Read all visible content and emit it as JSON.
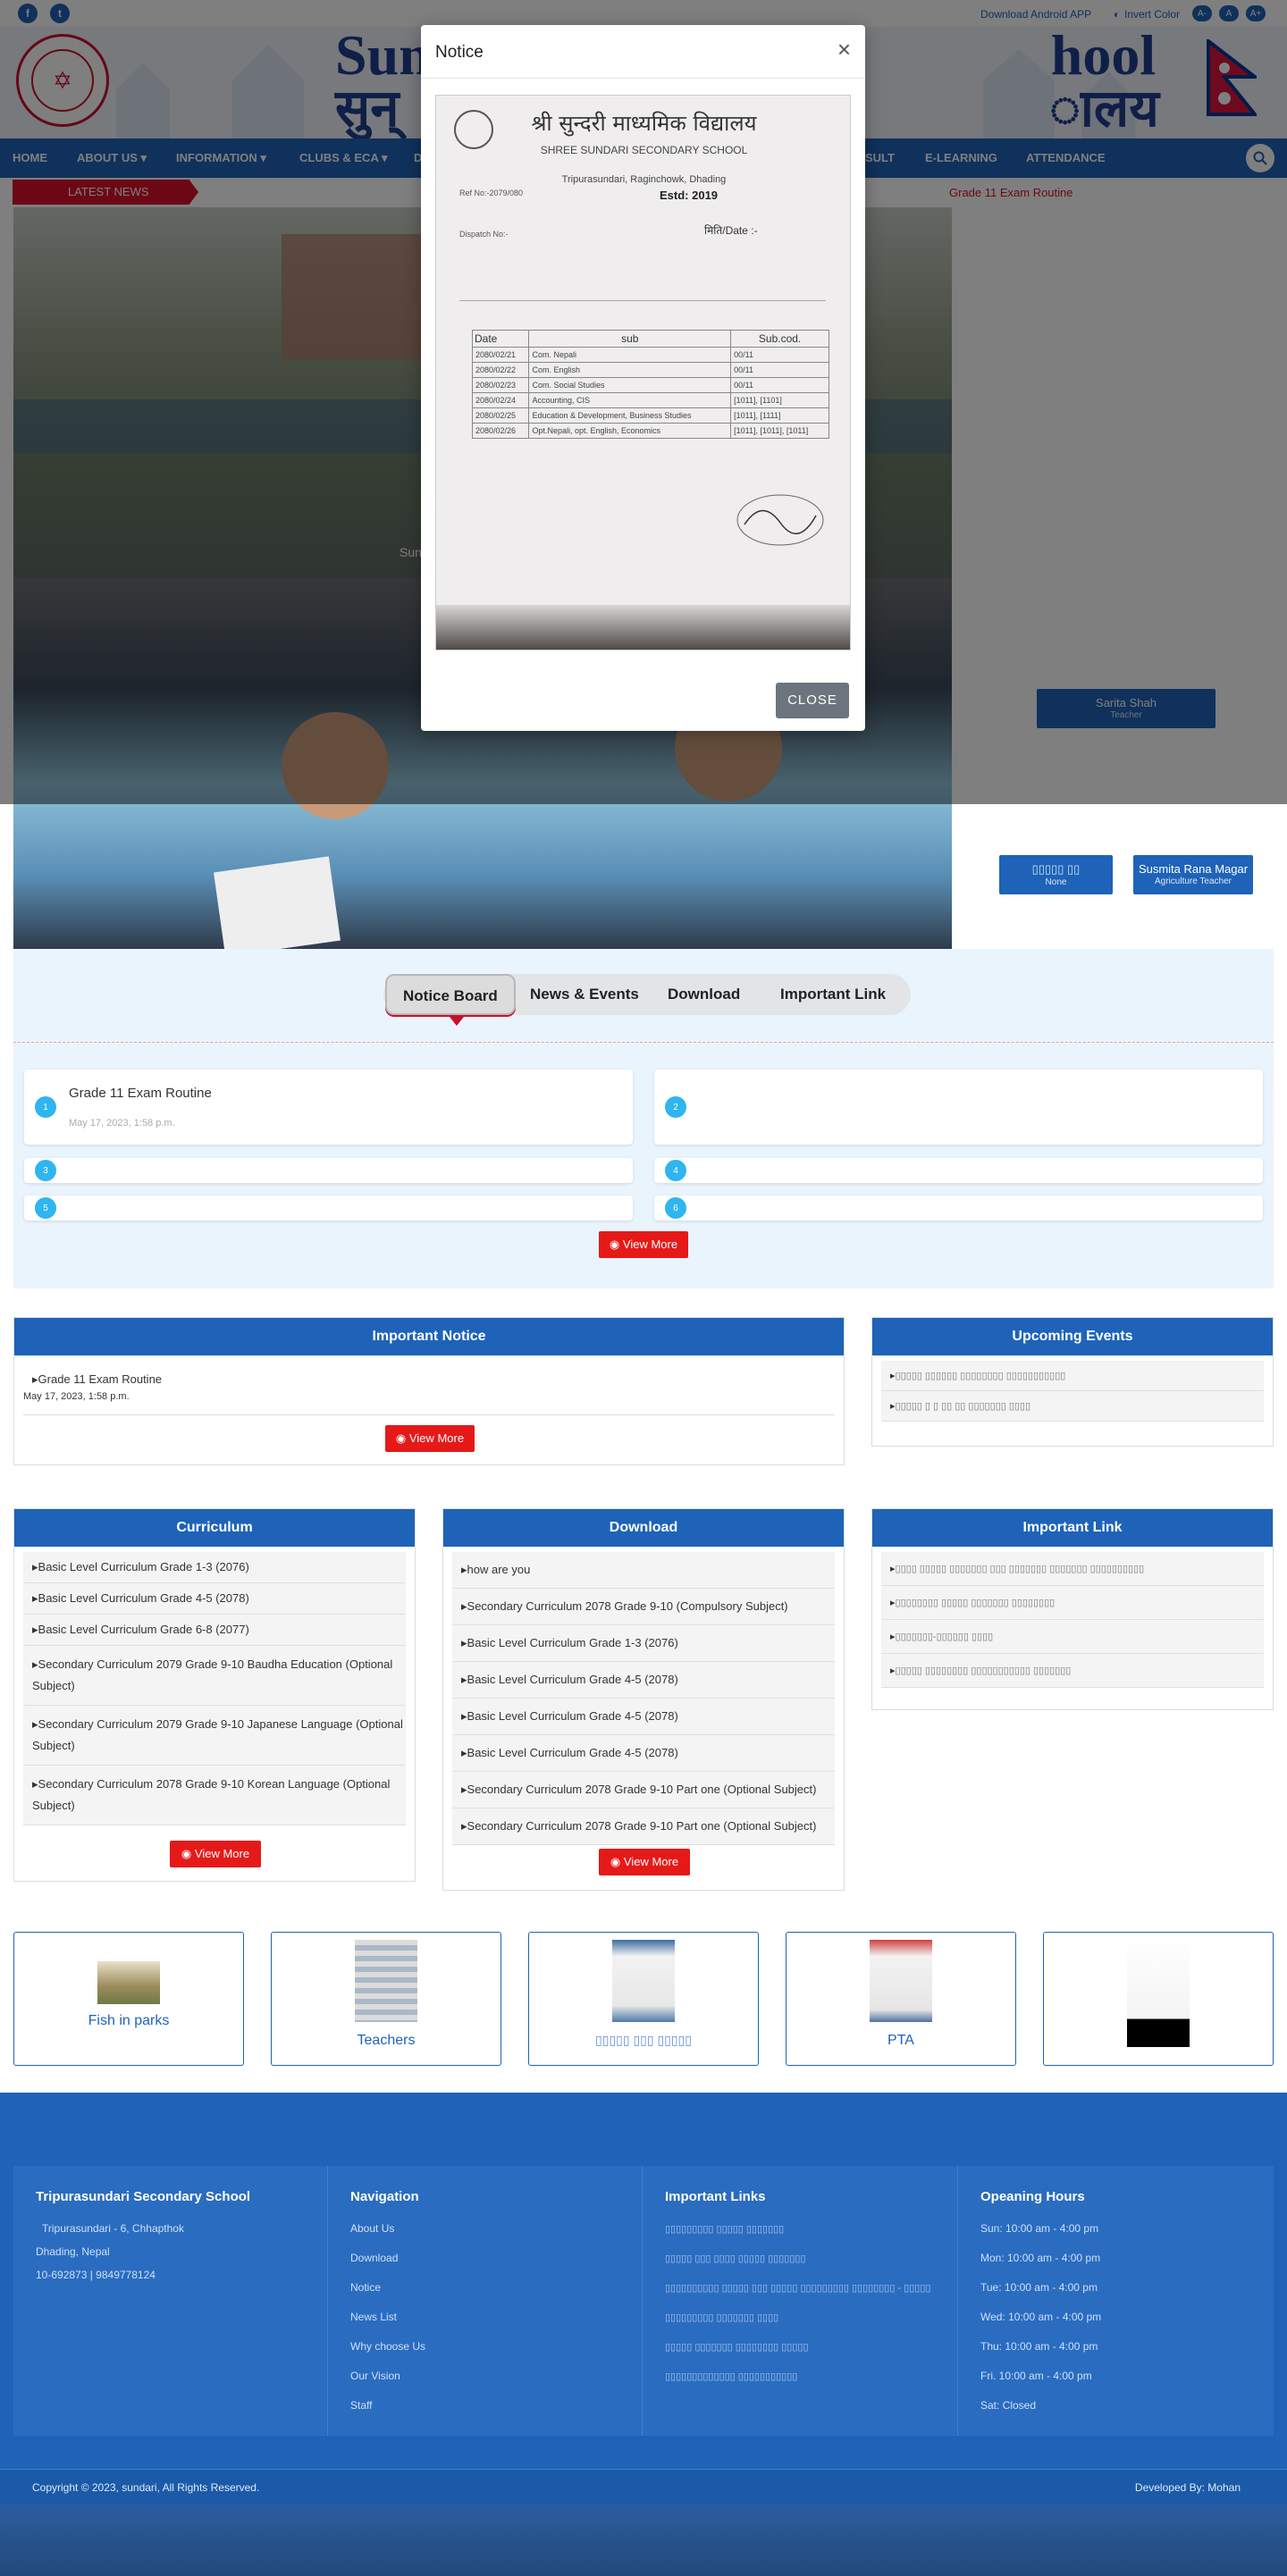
{
  "topbar": {
    "social": [
      "f",
      "t"
    ],
    "android_link": "Download Android APP",
    "invert_label": "Invert Color",
    "font_buttons": [
      "A-",
      "A",
      "A+"
    ]
  },
  "header": {
    "title_visible_left": "Sun",
    "title_visible_right": "hool",
    "subtitle_visible_left": "सुन्",
    "subtitle_visible_right": "ालय"
  },
  "nav": {
    "items": [
      "HOME",
      "ABOUT US",
      "INFORMATION",
      "CLUBS & ECA",
      "D",
      "SULT",
      "E-LEARNING",
      "ATTENDANCE"
    ]
  },
  "latest_news": {
    "label": "LATEST NEWS",
    "ticker": "Grade 11 Exam Routine"
  },
  "slider": {
    "caption": "Sun"
  },
  "staff": [
    {
      "name": "Sarita Shah",
      "role": "Teacher"
    },
    {
      "name": "▯▯▯▯▯ ▯▯",
      "role": "None"
    },
    {
      "name": "Susmita Rana Magar",
      "role": "Agriculture Teacher"
    }
  ],
  "tabs": [
    "Notice Board",
    "News & Events",
    "Download",
    "Important Link"
  ],
  "notice_board": {
    "items": [
      {
        "num": "1",
        "title": "Grade 11 Exam Routine",
        "date": "May 17, 2023, 1:58 p.m."
      },
      {
        "num": "2",
        "title": "",
        "date": ""
      },
      {
        "num": "3",
        "title": "",
        "date": ""
      },
      {
        "num": "4",
        "title": "",
        "date": ""
      },
      {
        "num": "5",
        "title": "",
        "date": ""
      },
      {
        "num": "6",
        "title": "",
        "date": ""
      }
    ],
    "view_more": "View More"
  },
  "important_notice": {
    "heading": "Important Notice",
    "item": "Grade 11 Exam Routine",
    "date": "May 17, 2023, 1:58 p.m.",
    "view_more": "View More"
  },
  "upcoming_events": {
    "heading": "Upcoming Events",
    "items": [
      "▯▯▯▯▯ ▯▯▯▯▯▯ ▯▯▯▯▯▯▯▯ ▯▯▯▯▯▯▯▯▯▯▯",
      "▯▯▯▯▯ ▯ ▯ ▯▯ ▯▯ ▯▯▯▯▯▯▯ ▯▯▯▯"
    ]
  },
  "curriculum": {
    "heading": "Curriculum",
    "items": [
      "Basic Level Curriculum Grade 1-3 (2076)",
      "Basic Level Curriculum Grade 4-5 (2078)",
      "Basic Level Curriculum Grade 6-8 (2077)",
      "Secondary Curriculum 2079 Grade 9-10 Baudha Education (Optional Subject)",
      "Secondary Curriculum 2079 Grade 9-10 Japanese Language (Optional Subject)",
      "Secondary Curriculum 2078 Grade 9-10 Korean Language (Optional Subject)"
    ],
    "view_more": "View More"
  },
  "download": {
    "heading": "Download",
    "items": [
      "how are you",
      "Secondary Curriculum 2078 Grade 9-10 (Compulsory Subject)",
      "Basic Level Curriculum Grade 1-3 (2076)",
      "Basic Level Curriculum Grade 4-5 (2078)",
      "Basic Level Curriculum Grade 4-5 (2078)",
      "Basic Level Curriculum Grade 4-5 (2078)",
      "Secondary Curriculum 2078 Grade 9-10 Part one (Optional Subject)",
      "Secondary Curriculum 2078 Grade 9-10 Part one (Optional Subject)"
    ],
    "view_more": "View More"
  },
  "important_link": {
    "heading": "Important Link",
    "items": [
      "▯▯▯▯ ▯▯▯▯▯ ▯▯▯▯▯▯▯ ▯▯▯ ▯▯▯▯▯▯▯ ▯▯▯▯▯▯▯ ▯▯▯▯▯▯▯▯▯▯",
      "▯▯▯▯▯▯▯▯ ▯▯▯▯▯ ▯▯▯▯▯▯▯ ▯▯▯▯▯▯▯▯",
      "▯▯▯▯▯▯▯-▯▯▯▯▯▯ ▯▯▯▯",
      "▯▯▯▯▯ ▯▯▯▯▯▯▯▯ ▯▯▯▯▯▯▯▯▯▯▯ ▯▯▯▯▯▯▯"
    ]
  },
  "gallery": [
    {
      "label": "Fish in parks"
    },
    {
      "label": "Teachers"
    },
    {
      "label": "▯▯▯▯▯ ▯▯▯ ▯▯▯▯▯"
    },
    {
      "label": "PTA"
    },
    {
      "label": ""
    }
  ],
  "footer": {
    "school": {
      "heading": "Tripurasundari Secondary School",
      "address1": "Tripurasundari - 6, Chhapthok",
      "address2": "Dhading, Nepal",
      "phone": "10-692873 | 9849778124"
    },
    "navigation": {
      "heading": "Navigation",
      "items": [
        "About Us",
        "Download",
        "Notice",
        "News List",
        "Why choose Us",
        "Our Vision",
        "Staff"
      ]
    },
    "important_links": {
      "heading": "Important Links",
      "items": [
        "▯▯▯▯▯▯▯▯▯ ▯▯▯▯▯ ▯▯▯▯▯▯▯",
        "▯▯▯▯▯ ▯▯▯ ▯▯▯▯ ▯▯▯▯▯ ▯▯▯▯▯▯▯",
        "▯▯▯▯▯▯▯▯▯▯ ▯▯▯▯▯ ▯▯▯ ▯▯▯▯▯ ▯▯▯▯▯▯▯▯▯ ▯▯▯▯▯▯▯▯ - ▯▯▯▯▯",
        "▯▯▯▯▯▯▯▯▯ ▯▯▯▯▯▯▯ ▯▯▯▯",
        "▯▯▯▯▯ ▯▯▯▯▯▯▯ ▯▯▯▯▯▯▯▯ ▯▯▯▯▯",
        "▯▯▯▯▯▯▯▯▯▯▯▯▯ ▯▯▯▯▯▯▯▯▯▯▯"
      ]
    },
    "hours": {
      "heading": "Opeaning Hours",
      "items": [
        "Sun: 10:00 am - 4:00 pm",
        "Mon: 10:00 am - 4:00 pm",
        "Tue: 10:00 am - 4:00 pm",
        "Wed: 10:00 am - 4:00 pm",
        "Thu: 10:00 am - 4:00 pm",
        "Fri. 10:00 am - 4:00 pm",
        "Sat: Closed"
      ]
    },
    "copyright": "Copyright © 2023, sundari, All Rights Reserved.",
    "developer": "Developed By: Mohan"
  },
  "modal": {
    "title": "Notice",
    "close_x": "×",
    "close_button": "CLOSE",
    "doc": {
      "title_nepali": "श्री सुन्दरी माध्यमिक विद्यालय",
      "school_en": "SHREE SUNDARI SECONDARY SCHOOL",
      "address_en": "Tripurasundari, Raginchowk, Dhading",
      "estd": "Estd: 2019",
      "ref": "Ref No:-2079/080",
      "dispatch": "Dispatch No:-",
      "date_lbl": "मिति/Date :-",
      "col_date": "Date",
      "col_sub": "sub",
      "col_code": "Sub.cod.",
      "rows": [
        {
          "date": "2080/02/21",
          "sub": "Com. Nepali",
          "code": "00/11"
        },
        {
          "date": "2080/02/22",
          "sub": "Com. English",
          "code": "00/11"
        },
        {
          "date": "2080/02/23",
          "sub": "Com. Social Studies",
          "code": "00/11"
        },
        {
          "date": "2080/02/24",
          "sub": "Accounting, CIS",
          "code": "[1011],   [1101]"
        },
        {
          "date": "2080/02/25",
          "sub": "Education & Development, Business Studies",
          "code": "[1011],   [1111]"
        },
        {
          "date": "2080/02/26",
          "sub": "Opt.Nepali, opt. English, Economics",
          "code": "[1011],   [1011],   [1011]"
        }
      ]
    }
  }
}
